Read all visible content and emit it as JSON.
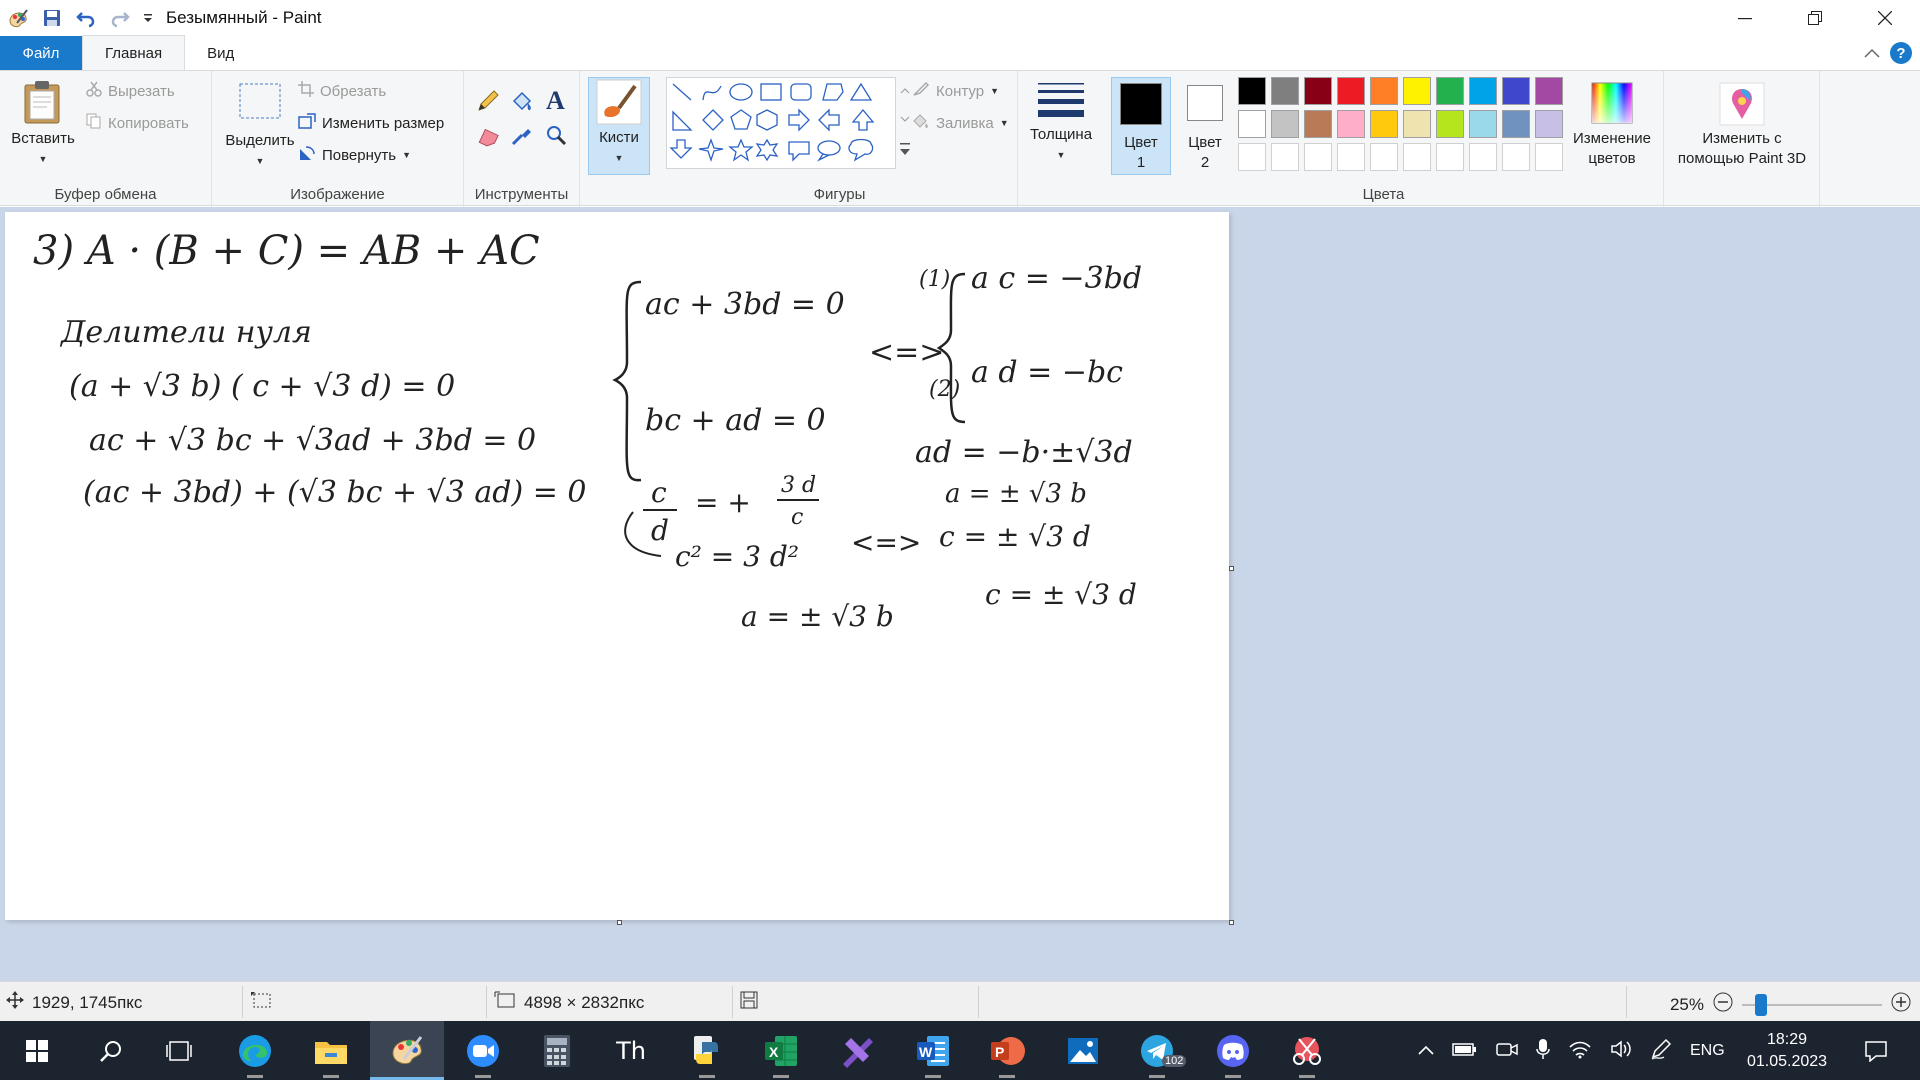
{
  "window": {
    "title": "Безымянный - Paint",
    "controls": [
      "minimize-icon",
      "restore-icon",
      "close-icon"
    ]
  },
  "tabs": [
    {
      "label": "Файл"
    },
    {
      "label": "Главная"
    },
    {
      "label": "Вид"
    }
  ],
  "ribbon": {
    "clipboard": {
      "paste_label": "Вставить",
      "cut_label": "Вырезать",
      "copy_label": "Копировать",
      "group_label": "Буфер обмена"
    },
    "image": {
      "select_label": "Выделить",
      "crop_label": "Обрезать",
      "resize_label": "Изменить размер",
      "rotate_label": "Повернуть",
      "group_label": "Изображение"
    },
    "tools": {
      "group_label": "Инструменты"
    },
    "brushes": {
      "label": "Кисти"
    },
    "shapes": {
      "outline_label": "Контур",
      "fill_label": "Заливка",
      "group_label": "Фигуры"
    },
    "size": {
      "label": "Толщина"
    },
    "colors": {
      "color1_line1": "Цвет",
      "color1_line2": "1",
      "color2_line1": "Цвет",
      "color2_line2": "2",
      "edit_line1": "Изменение",
      "edit_line2": "цветов",
      "group_label": "Цвета",
      "palette_row1": [
        "#000000",
        "#7f7f7f",
        "#880015",
        "#ed1c24",
        "#ff7f27",
        "#fff200",
        "#22b14c",
        "#00a2e8",
        "#3f48cc",
        "#a349a4"
      ],
      "palette_row2": [
        "#ffffff",
        "#c3c3c3",
        "#b97a57",
        "#ffaec9",
        "#ffc90e",
        "#efe4b0",
        "#b5e61d",
        "#99d9ea",
        "#7092be",
        "#c8bfe7"
      ],
      "color1": "#000000",
      "color2": "#ffffff"
    },
    "paint3d": {
      "line1": "Изменить с",
      "line2": "помощью Paint 3D"
    }
  },
  "statusbar": {
    "cursor_pos": "1929, 1745пкс",
    "image_size": "4898 × 2832пкс",
    "zoom": "25%",
    "zoom_fraction": 0.1
  },
  "canvas_text": {
    "line1": "3)   A · (B + C) =   AB + AC",
    "line2": "Делители нуля",
    "line3": "(a + √3 b) ( c + √3 d) = 0",
    "line4": "ac + √3 bc + √3ad + 3bd = 0",
    "line5": "(ac + 3bd) + (√3 bc + √3 ad) = 0",
    "sys1": "ac + 3bd = 0",
    "sys2": "bc + ad = 0",
    "equiv1": "<=>",
    "r1label": "(1)",
    "r1": "a c = −3bd",
    "r2label": "(2)",
    "r2": "a d = −bc",
    "r3": "ad = −b·±√3d",
    "r4": "a = ± √3 b",
    "frac_lhs_num": "c",
    "frac_lhs_den": "d",
    "frac_eq": "= +",
    "frac_rhs_num": "3 d",
    "frac_rhs_den": "c",
    "csq": "c² = 3 d²",
    "equiv2": "<=>",
    "cres": "c = ± √3 d",
    "ares": "a = ± √3 b",
    "cres2": "c = ± √3 d"
  },
  "taskbar": {
    "apps": [
      "windows-start-icon",
      "search-icon",
      "task-view-icon",
      "edge-icon",
      "file-explorer-icon",
      "paint-icon",
      "zoom-icon",
      "calculator-icon",
      "fonts-icon",
      "python-icon",
      "excel-icon",
      "onenote-icon",
      "word-icon",
      "powerpoint-icon",
      "photos-icon",
      "telegram-icon",
      "discord-icon",
      "snipping-tool-icon"
    ],
    "telegram_badge": "102",
    "lang": "ENG",
    "time": "18:29",
    "date": "01.05.2023"
  }
}
